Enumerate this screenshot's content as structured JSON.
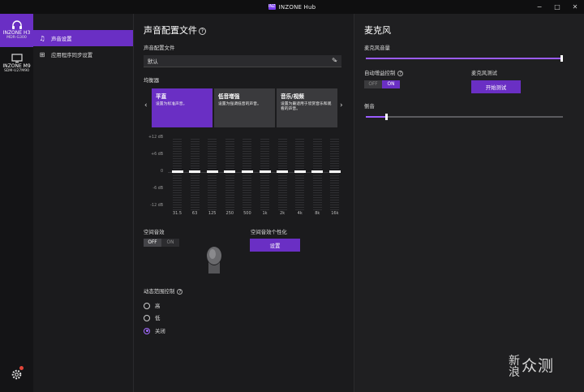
{
  "app": {
    "title": "INZONE Hub",
    "logo": "INZ"
  },
  "window": {
    "minimize": "−",
    "maximize": "□",
    "close": "✕"
  },
  "devices": [
    {
      "name": "INZONE H3",
      "model": "MDR-G300",
      "icon": "headphones-icon"
    },
    {
      "name": "INZONE M9",
      "model": "SDM-U27M90",
      "icon": "monitor-icon"
    }
  ],
  "subnav": [
    {
      "label": "声音设置",
      "icon": "music-note-icon"
    },
    {
      "label": "应用程序同步设置",
      "icon": "grid-icon"
    }
  ],
  "main": {
    "title": "声音配置文件",
    "help": "?",
    "profile_label": "声音配置文件",
    "profile_value": "默认",
    "eq_label": "均衡器",
    "presets": [
      {
        "title": "平直",
        "desc": "设置为标准声音。"
      },
      {
        "title": "低音增强",
        "desc": "设置为强调低音的声音。"
      },
      {
        "title": "音乐/视频",
        "desc": "设置为最适用于欣赏音乐和观看的声音。"
      }
    ],
    "db_ticks": [
      "+12 dB",
      "+6 dB",
      "0",
      "-6 dB",
      "-12 dB"
    ],
    "freqs": [
      "31.5",
      "63",
      "125",
      "250",
      "500",
      "1k",
      "2k",
      "4k",
      "8k",
      "16k"
    ],
    "eq_values_db": [
      0,
      0,
      0,
      0,
      0,
      0,
      0,
      0,
      0,
      0
    ],
    "spatial_label": "空间音效",
    "spatial_off": "OFF",
    "spatial_on": "ON",
    "spatial_personal_label": "空间音效个性化",
    "spatial_personal_button": "设置",
    "drc_label": "动态范围控制",
    "drc_options": [
      "高",
      "低",
      "关闭"
    ],
    "drc_selected": "关闭"
  },
  "mic": {
    "title": "麦克风",
    "volume_label": "麦克风音量",
    "volume_value": 1.0,
    "agc_label": "自动增益控制",
    "agc_off": "OFF",
    "agc_on": "ON",
    "test_label": "麦克风测试",
    "test_button": "开始测试",
    "sidetone_label": "侧音",
    "sidetone_value": 0.1
  },
  "watermark": {
    "big": "众测",
    "small1": "新",
    "small2": "浪"
  },
  "colors": {
    "accent": "#6a2fc4",
    "slider": "#9b5cff"
  }
}
